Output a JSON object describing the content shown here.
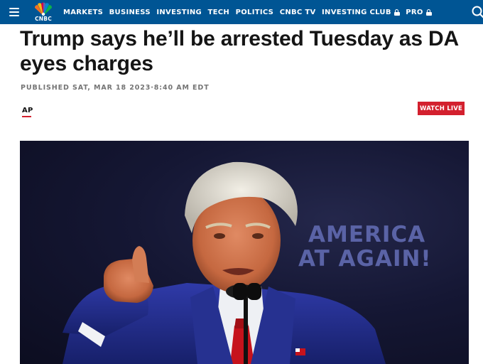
{
  "nav": {
    "menu_icon": "hamburger-menu-icon",
    "logo_text": "CNBC",
    "logo_colors": [
      "#f37021",
      "#fcb711",
      "#cc004c",
      "#6460aa",
      "#0089d0",
      "#0db14b"
    ],
    "items": [
      {
        "label": "MARKETS",
        "locked": false
      },
      {
        "label": "BUSINESS",
        "locked": false
      },
      {
        "label": "INVESTING",
        "locked": false
      },
      {
        "label": "TECH",
        "locked": false
      },
      {
        "label": "POLITICS",
        "locked": false
      },
      {
        "label": "CNBC TV",
        "locked": false
      },
      {
        "label": "INVESTING CLUB",
        "locked": true
      },
      {
        "label": "PRO",
        "locked": true
      }
    ],
    "search_icon": "search-icon",
    "background": "#005594"
  },
  "article": {
    "headline": "Trump says he’ll be arrested Tuesday as DA eyes charges",
    "published": "PUBLISHED SAT, MAR 18 2023·8:40 AM EDT",
    "source": "AP",
    "watch_live": "WATCH LIVE",
    "accent_color": "#d3202e"
  },
  "hero_image": {
    "backdrop_lines": [
      "AMERICA",
      "AT AGAIN!"
    ],
    "description_icon": "photo"
  }
}
